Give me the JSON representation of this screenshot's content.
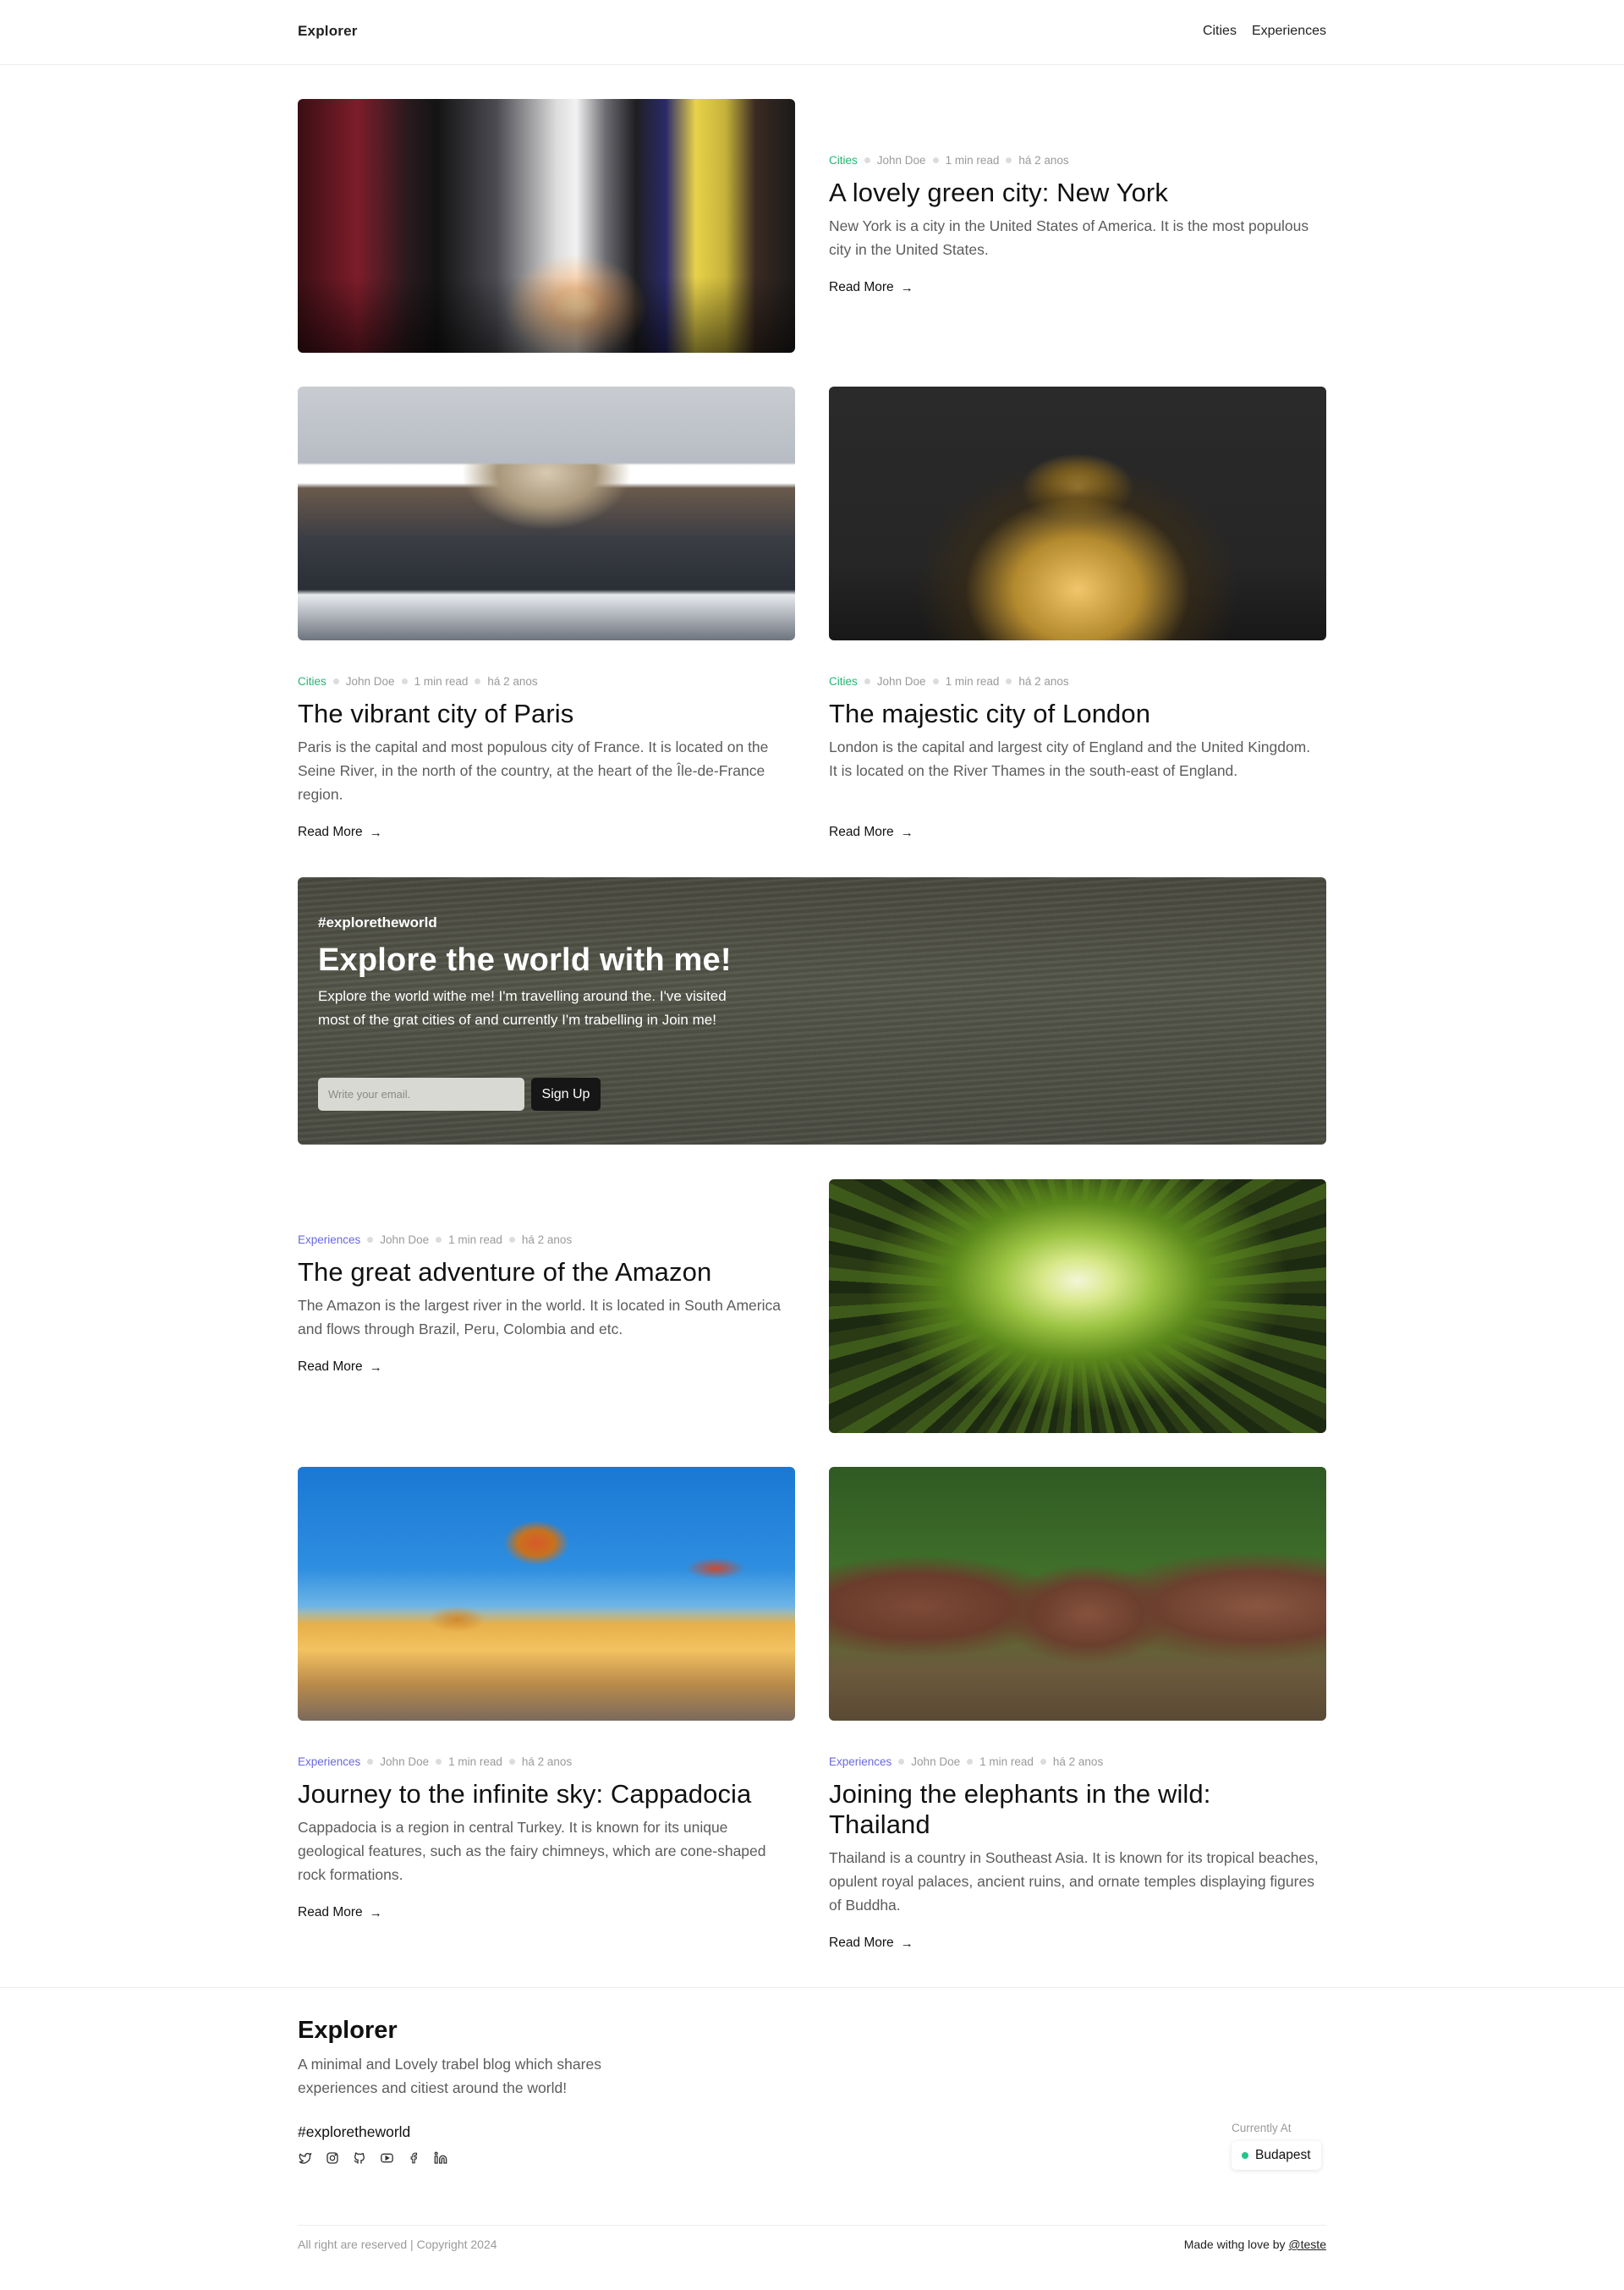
{
  "header": {
    "brand": "Explorer",
    "nav": [
      "Cities",
      "Experiences"
    ]
  },
  "posts": [
    {
      "category": "Cities",
      "author": "John Doe",
      "read_time": "1 min read",
      "date": "há 2 anos",
      "title": "A lovely green city: New York",
      "description": "New York is a city in the United States of America. It is the most populous city in the United States.",
      "read_more": "Read More"
    },
    {
      "category": "Cities",
      "author": "John Doe",
      "read_time": "1 min read",
      "date": "há 2 anos",
      "title": "The vibrant city of Paris",
      "description": "Paris is the capital and most populous city of France. It is located on the Seine River, in the north of the country, at the heart of the Île-de-France region.",
      "read_more": "Read More"
    },
    {
      "category": "Cities",
      "author": "John Doe",
      "read_time": "1 min read",
      "date": "há 2 anos",
      "title": "The majestic city of London",
      "description": "London is the capital and largest city of England and the United Kingdom. It is located on the River Thames in the south-east of England.",
      "read_more": "Read More"
    },
    {
      "category": "Experiences",
      "author": "John Doe",
      "read_time": "1 min read",
      "date": "há 2 anos",
      "title": "The great adventure of the Amazon",
      "description": "The Amazon is the largest river in the world. It is located in South America and flows through Brazil, Peru, Colombia and etc.",
      "read_more": "Read More"
    },
    {
      "category": "Experiences",
      "author": "John Doe",
      "read_time": "1 min read",
      "date": "há 2 anos",
      "title": "Journey to the infinite sky: Cappadocia",
      "description": "Cappadocia is a region in central Turkey. It is known for its unique geological features, such as the fairy chimneys, which are cone-shaped rock formations.",
      "read_more": "Read More"
    },
    {
      "category": "Experiences",
      "author": "John Doe",
      "read_time": "1 min read",
      "date": "há 2 anos",
      "title": "Joining the elephants in the wild: Thailand",
      "description": "Thailand is a country in Southeast Asia. It is known for its tropical beaches, opulent royal palaces, ancient ruins, and ornate temples displaying figures of Buddha.",
      "read_more": "Read More"
    }
  ],
  "banner": {
    "tag": "#exploretheworld",
    "title": "Explore the world with me!",
    "description": "Explore the world withe me! I'm travelling around the. I've visited most of the grat cities of and currently I'm trabelling in Join me!",
    "email_placeholder": "Write your email.",
    "button": "Sign Up"
  },
  "footer": {
    "brand": "Explorer",
    "description": "A minimal and Lovely trabel blog which shares experiences and citiest around the world!",
    "tag": "#exploretheworld",
    "social": [
      "twitter-icon",
      "instagram-icon",
      "github-icon",
      "youtube-icon",
      "facebook-icon",
      "linkedin-icon"
    ],
    "currently_label": "Currently At",
    "currently_value": "Budapest",
    "copyright": "All right are reserved | Copyright 2024",
    "made_with": "Made withg love by ",
    "made_by": "@teste"
  },
  "colors": {
    "cities": "#22b573",
    "experiences": "#6a67e0",
    "status_green": "#22c58b"
  }
}
